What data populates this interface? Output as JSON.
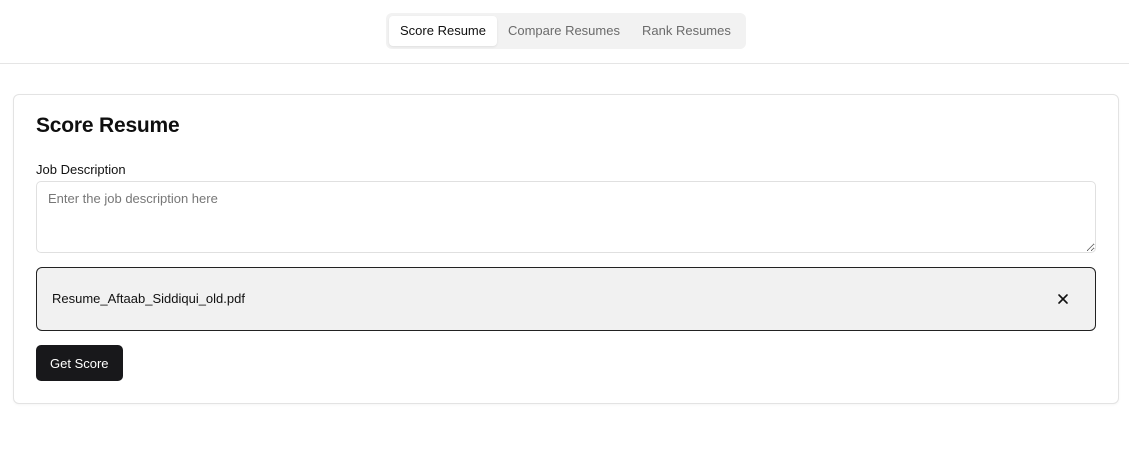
{
  "nav": {
    "tabs": [
      {
        "label": "Score Resume",
        "active": true
      },
      {
        "label": "Compare Resumes",
        "active": false
      },
      {
        "label": "Rank Resumes",
        "active": false
      }
    ]
  },
  "card": {
    "title": "Score Resume",
    "job_description": {
      "label": "Job Description",
      "value": "",
      "placeholder": "Enter the job description here"
    },
    "file": {
      "name": "Resume_Aftaab_Siddiqui_old.pdf",
      "remove_icon": "close-icon"
    },
    "submit_label": "Get Score"
  },
  "colors": {
    "primary_button": "#18181b",
    "tab_track": "#f2f2f2",
    "file_box_bg": "#f1f1f1"
  }
}
